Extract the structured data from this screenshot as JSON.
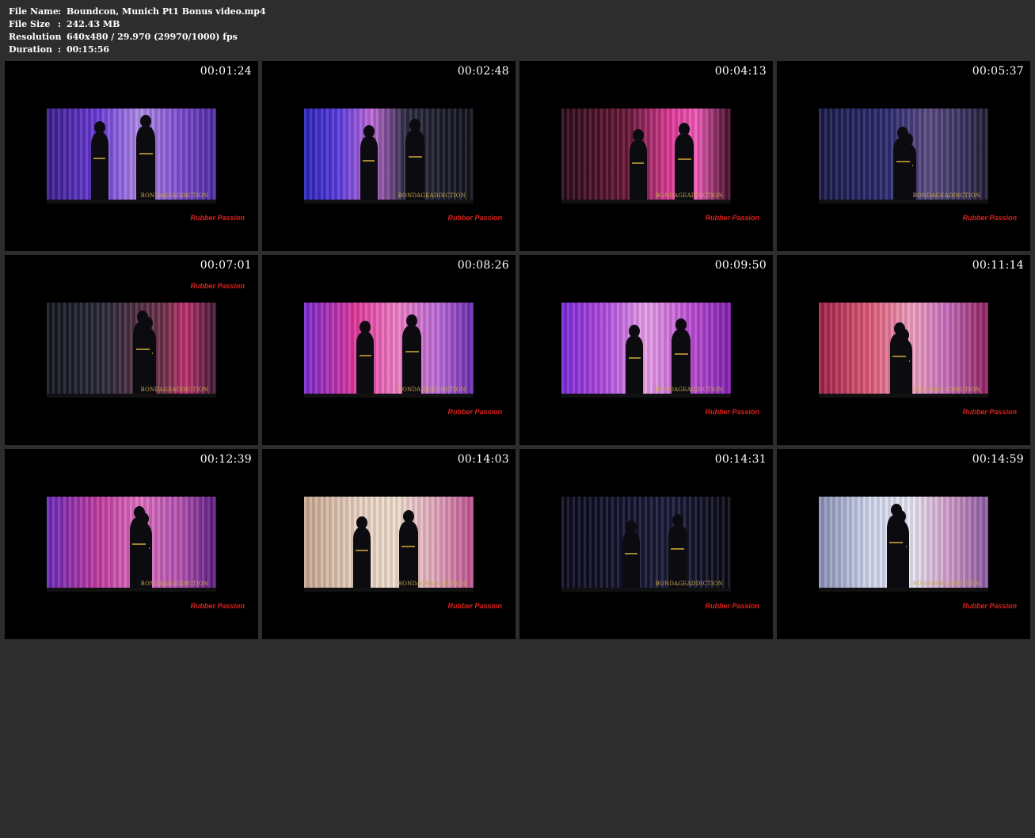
{
  "file_info": {
    "rows": [
      {
        "key": "File Name",
        "sep": ":",
        "value": "Boundcon, Munich Pt1 Bonus video.mp4"
      },
      {
        "key": "File Size",
        "sep": ":",
        "value": "242.43 MB"
      },
      {
        "key": "Resolution",
        "sep": ":",
        "value": "640x480 / 29.970 (29970/1000) fps"
      },
      {
        "key": "Duration",
        "sep": ":",
        "value": "00:15:56"
      }
    ]
  },
  "thumbnails": [
    {
      "timestamp": "00:01:24",
      "bg": "linear-gradient(90deg,#3a1f8a,#6a38d8 30%,#b08ce8 55%,#7a48d0 80%,#4a2aa0)",
      "brand": "Rubber Passion",
      "watermark": "BONDAGEADDICTION"
    },
    {
      "timestamp": "00:02:48",
      "bg": "linear-gradient(90deg,#2a24b8,#5a3ae0 20%,#c06ad8 40%,#2a2a40 60%,#101018)",
      "brand": "Rubber Passion",
      "watermark": "BONDAGEADDICTION"
    },
    {
      "timestamp": "00:04:13",
      "bg": "linear-gradient(90deg,#2a0a18,#6a1838 40%,#e03a9a 65%,#f05ab8 80%,#3a0a20)",
      "brand": "Rubber Passion",
      "watermark": "BONDAGEADDICTION"
    },
    {
      "timestamp": "00:05:37",
      "bg": "linear-gradient(90deg,#1a1a48,#2c2a70 40%,#5a4a80 65%,#3a3460 85%,#201a30)",
      "brand": "Rubber Passion",
      "watermark": "BONDAGEADDICTION"
    },
    {
      "timestamp": "00:07:01",
      "bg": "linear-gradient(90deg,#151520,#2a2a38 35%,#70304a 70%,#c03070 82%,#3a1830)",
      "brand": "Rubber Passion",
      "watermark": "BONDAGEADDICTION"
    },
    {
      "timestamp": "00:08:26",
      "bg": "linear-gradient(90deg,#7a2ad0,#e0369a 30%,#f080c8 55%,#b86ad8 80%,#6a2ab0)",
      "brand": "Rubber Passion",
      "watermark": "BONDAGEADDICTION"
    },
    {
      "timestamp": "00:09:50",
      "bg": "linear-gradient(90deg,#7a2ad8,#b04ae0 25%,#e8a0e8 50%,#c050d8 75%,#8020b0)",
      "brand": "Rubber Passion",
      "watermark": "BONDAGEADDICTION"
    },
    {
      "timestamp": "00:11:14",
      "bg": "linear-gradient(90deg,#a02048,#e05a78 30%,#f0a0c0 55%,#c870c0 75%,#902060)",
      "brand": "Rubber Passion",
      "watermark": "BONDAGEADDICTION"
    },
    {
      "timestamp": "00:12:39",
      "bg": "linear-gradient(90deg,#6a2ab8,#c03aa0 30%,#e070c0 55%,#b050b0 80%,#5a1a80)",
      "brand": "Rubber Passion",
      "watermark": "BONDAGEADDICTION"
    },
    {
      "timestamp": "00:14:03",
      "bg": "linear-gradient(90deg,#c8a890,#e8d0c0 30%,#f0e0d0 55%,#e0a0b8 80%,#c05090)",
      "brand": "Rubber Passion",
      "watermark": "BONDAGEADDICTION"
    },
    {
      "timestamp": "00:14:31",
      "bg": "linear-gradient(90deg,#0a0a1c,#141430 40%,#1a1a38 65%,#101024 85%,#08080f)",
      "brand": "Rubber Passion",
      "watermark": "BONDAGEADDICTION"
    },
    {
      "timestamp": "00:14:59",
      "bg": "linear-gradient(90deg,#8a90b8,#d0d8ee 30%,#e8e8f4 55%,#d098c8 78%,#8a5aa0)",
      "brand": "Rubber Passion",
      "watermark": "BONDAGEADDICTION"
    }
  ]
}
